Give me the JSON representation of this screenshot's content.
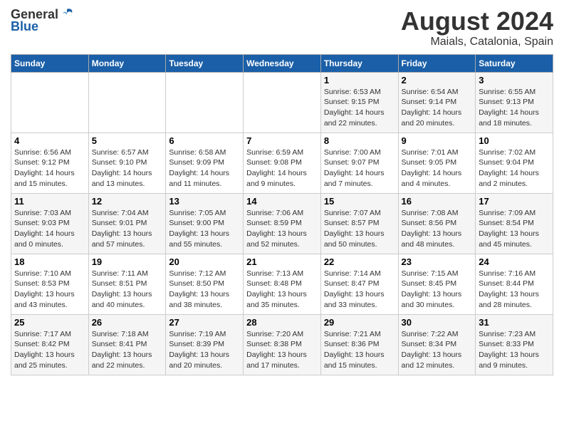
{
  "header": {
    "logo_general": "General",
    "logo_blue": "Blue",
    "main_title": "August 2024",
    "subtitle": "Maials, Catalonia, Spain"
  },
  "columns": [
    "Sunday",
    "Monday",
    "Tuesday",
    "Wednesday",
    "Thursday",
    "Friday",
    "Saturday"
  ],
  "weeks": [
    {
      "days": [
        {
          "num": "",
          "info": ""
        },
        {
          "num": "",
          "info": ""
        },
        {
          "num": "",
          "info": ""
        },
        {
          "num": "",
          "info": ""
        },
        {
          "num": "1",
          "info": "Sunrise: 6:53 AM\nSunset: 9:15 PM\nDaylight: 14 hours\nand 22 minutes."
        },
        {
          "num": "2",
          "info": "Sunrise: 6:54 AM\nSunset: 9:14 PM\nDaylight: 14 hours\nand 20 minutes."
        },
        {
          "num": "3",
          "info": "Sunrise: 6:55 AM\nSunset: 9:13 PM\nDaylight: 14 hours\nand 18 minutes."
        }
      ]
    },
    {
      "days": [
        {
          "num": "4",
          "info": "Sunrise: 6:56 AM\nSunset: 9:12 PM\nDaylight: 14 hours\nand 15 minutes."
        },
        {
          "num": "5",
          "info": "Sunrise: 6:57 AM\nSunset: 9:10 PM\nDaylight: 14 hours\nand 13 minutes."
        },
        {
          "num": "6",
          "info": "Sunrise: 6:58 AM\nSunset: 9:09 PM\nDaylight: 14 hours\nand 11 minutes."
        },
        {
          "num": "7",
          "info": "Sunrise: 6:59 AM\nSunset: 9:08 PM\nDaylight: 14 hours\nand 9 minutes."
        },
        {
          "num": "8",
          "info": "Sunrise: 7:00 AM\nSunset: 9:07 PM\nDaylight: 14 hours\nand 7 minutes."
        },
        {
          "num": "9",
          "info": "Sunrise: 7:01 AM\nSunset: 9:05 PM\nDaylight: 14 hours\nand 4 minutes."
        },
        {
          "num": "10",
          "info": "Sunrise: 7:02 AM\nSunset: 9:04 PM\nDaylight: 14 hours\nand 2 minutes."
        }
      ]
    },
    {
      "days": [
        {
          "num": "11",
          "info": "Sunrise: 7:03 AM\nSunset: 9:03 PM\nDaylight: 14 hours\nand 0 minutes."
        },
        {
          "num": "12",
          "info": "Sunrise: 7:04 AM\nSunset: 9:01 PM\nDaylight: 13 hours\nand 57 minutes."
        },
        {
          "num": "13",
          "info": "Sunrise: 7:05 AM\nSunset: 9:00 PM\nDaylight: 13 hours\nand 55 minutes."
        },
        {
          "num": "14",
          "info": "Sunrise: 7:06 AM\nSunset: 8:59 PM\nDaylight: 13 hours\nand 52 minutes."
        },
        {
          "num": "15",
          "info": "Sunrise: 7:07 AM\nSunset: 8:57 PM\nDaylight: 13 hours\nand 50 minutes."
        },
        {
          "num": "16",
          "info": "Sunrise: 7:08 AM\nSunset: 8:56 PM\nDaylight: 13 hours\nand 48 minutes."
        },
        {
          "num": "17",
          "info": "Sunrise: 7:09 AM\nSunset: 8:54 PM\nDaylight: 13 hours\nand 45 minutes."
        }
      ]
    },
    {
      "days": [
        {
          "num": "18",
          "info": "Sunrise: 7:10 AM\nSunset: 8:53 PM\nDaylight: 13 hours\nand 43 minutes."
        },
        {
          "num": "19",
          "info": "Sunrise: 7:11 AM\nSunset: 8:51 PM\nDaylight: 13 hours\nand 40 minutes."
        },
        {
          "num": "20",
          "info": "Sunrise: 7:12 AM\nSunset: 8:50 PM\nDaylight: 13 hours\nand 38 minutes."
        },
        {
          "num": "21",
          "info": "Sunrise: 7:13 AM\nSunset: 8:48 PM\nDaylight: 13 hours\nand 35 minutes."
        },
        {
          "num": "22",
          "info": "Sunrise: 7:14 AM\nSunset: 8:47 PM\nDaylight: 13 hours\nand 33 minutes."
        },
        {
          "num": "23",
          "info": "Sunrise: 7:15 AM\nSunset: 8:45 PM\nDaylight: 13 hours\nand 30 minutes."
        },
        {
          "num": "24",
          "info": "Sunrise: 7:16 AM\nSunset: 8:44 PM\nDaylight: 13 hours\nand 28 minutes."
        }
      ]
    },
    {
      "days": [
        {
          "num": "25",
          "info": "Sunrise: 7:17 AM\nSunset: 8:42 PM\nDaylight: 13 hours\nand 25 minutes."
        },
        {
          "num": "26",
          "info": "Sunrise: 7:18 AM\nSunset: 8:41 PM\nDaylight: 13 hours\nand 22 minutes."
        },
        {
          "num": "27",
          "info": "Sunrise: 7:19 AM\nSunset: 8:39 PM\nDaylight: 13 hours\nand 20 minutes."
        },
        {
          "num": "28",
          "info": "Sunrise: 7:20 AM\nSunset: 8:38 PM\nDaylight: 13 hours\nand 17 minutes."
        },
        {
          "num": "29",
          "info": "Sunrise: 7:21 AM\nSunset: 8:36 PM\nDaylight: 13 hours\nand 15 minutes."
        },
        {
          "num": "30",
          "info": "Sunrise: 7:22 AM\nSunset: 8:34 PM\nDaylight: 13 hours\nand 12 minutes."
        },
        {
          "num": "31",
          "info": "Sunrise: 7:23 AM\nSunset: 8:33 PM\nDaylight: 13 hours\nand 9 minutes."
        }
      ]
    }
  ]
}
